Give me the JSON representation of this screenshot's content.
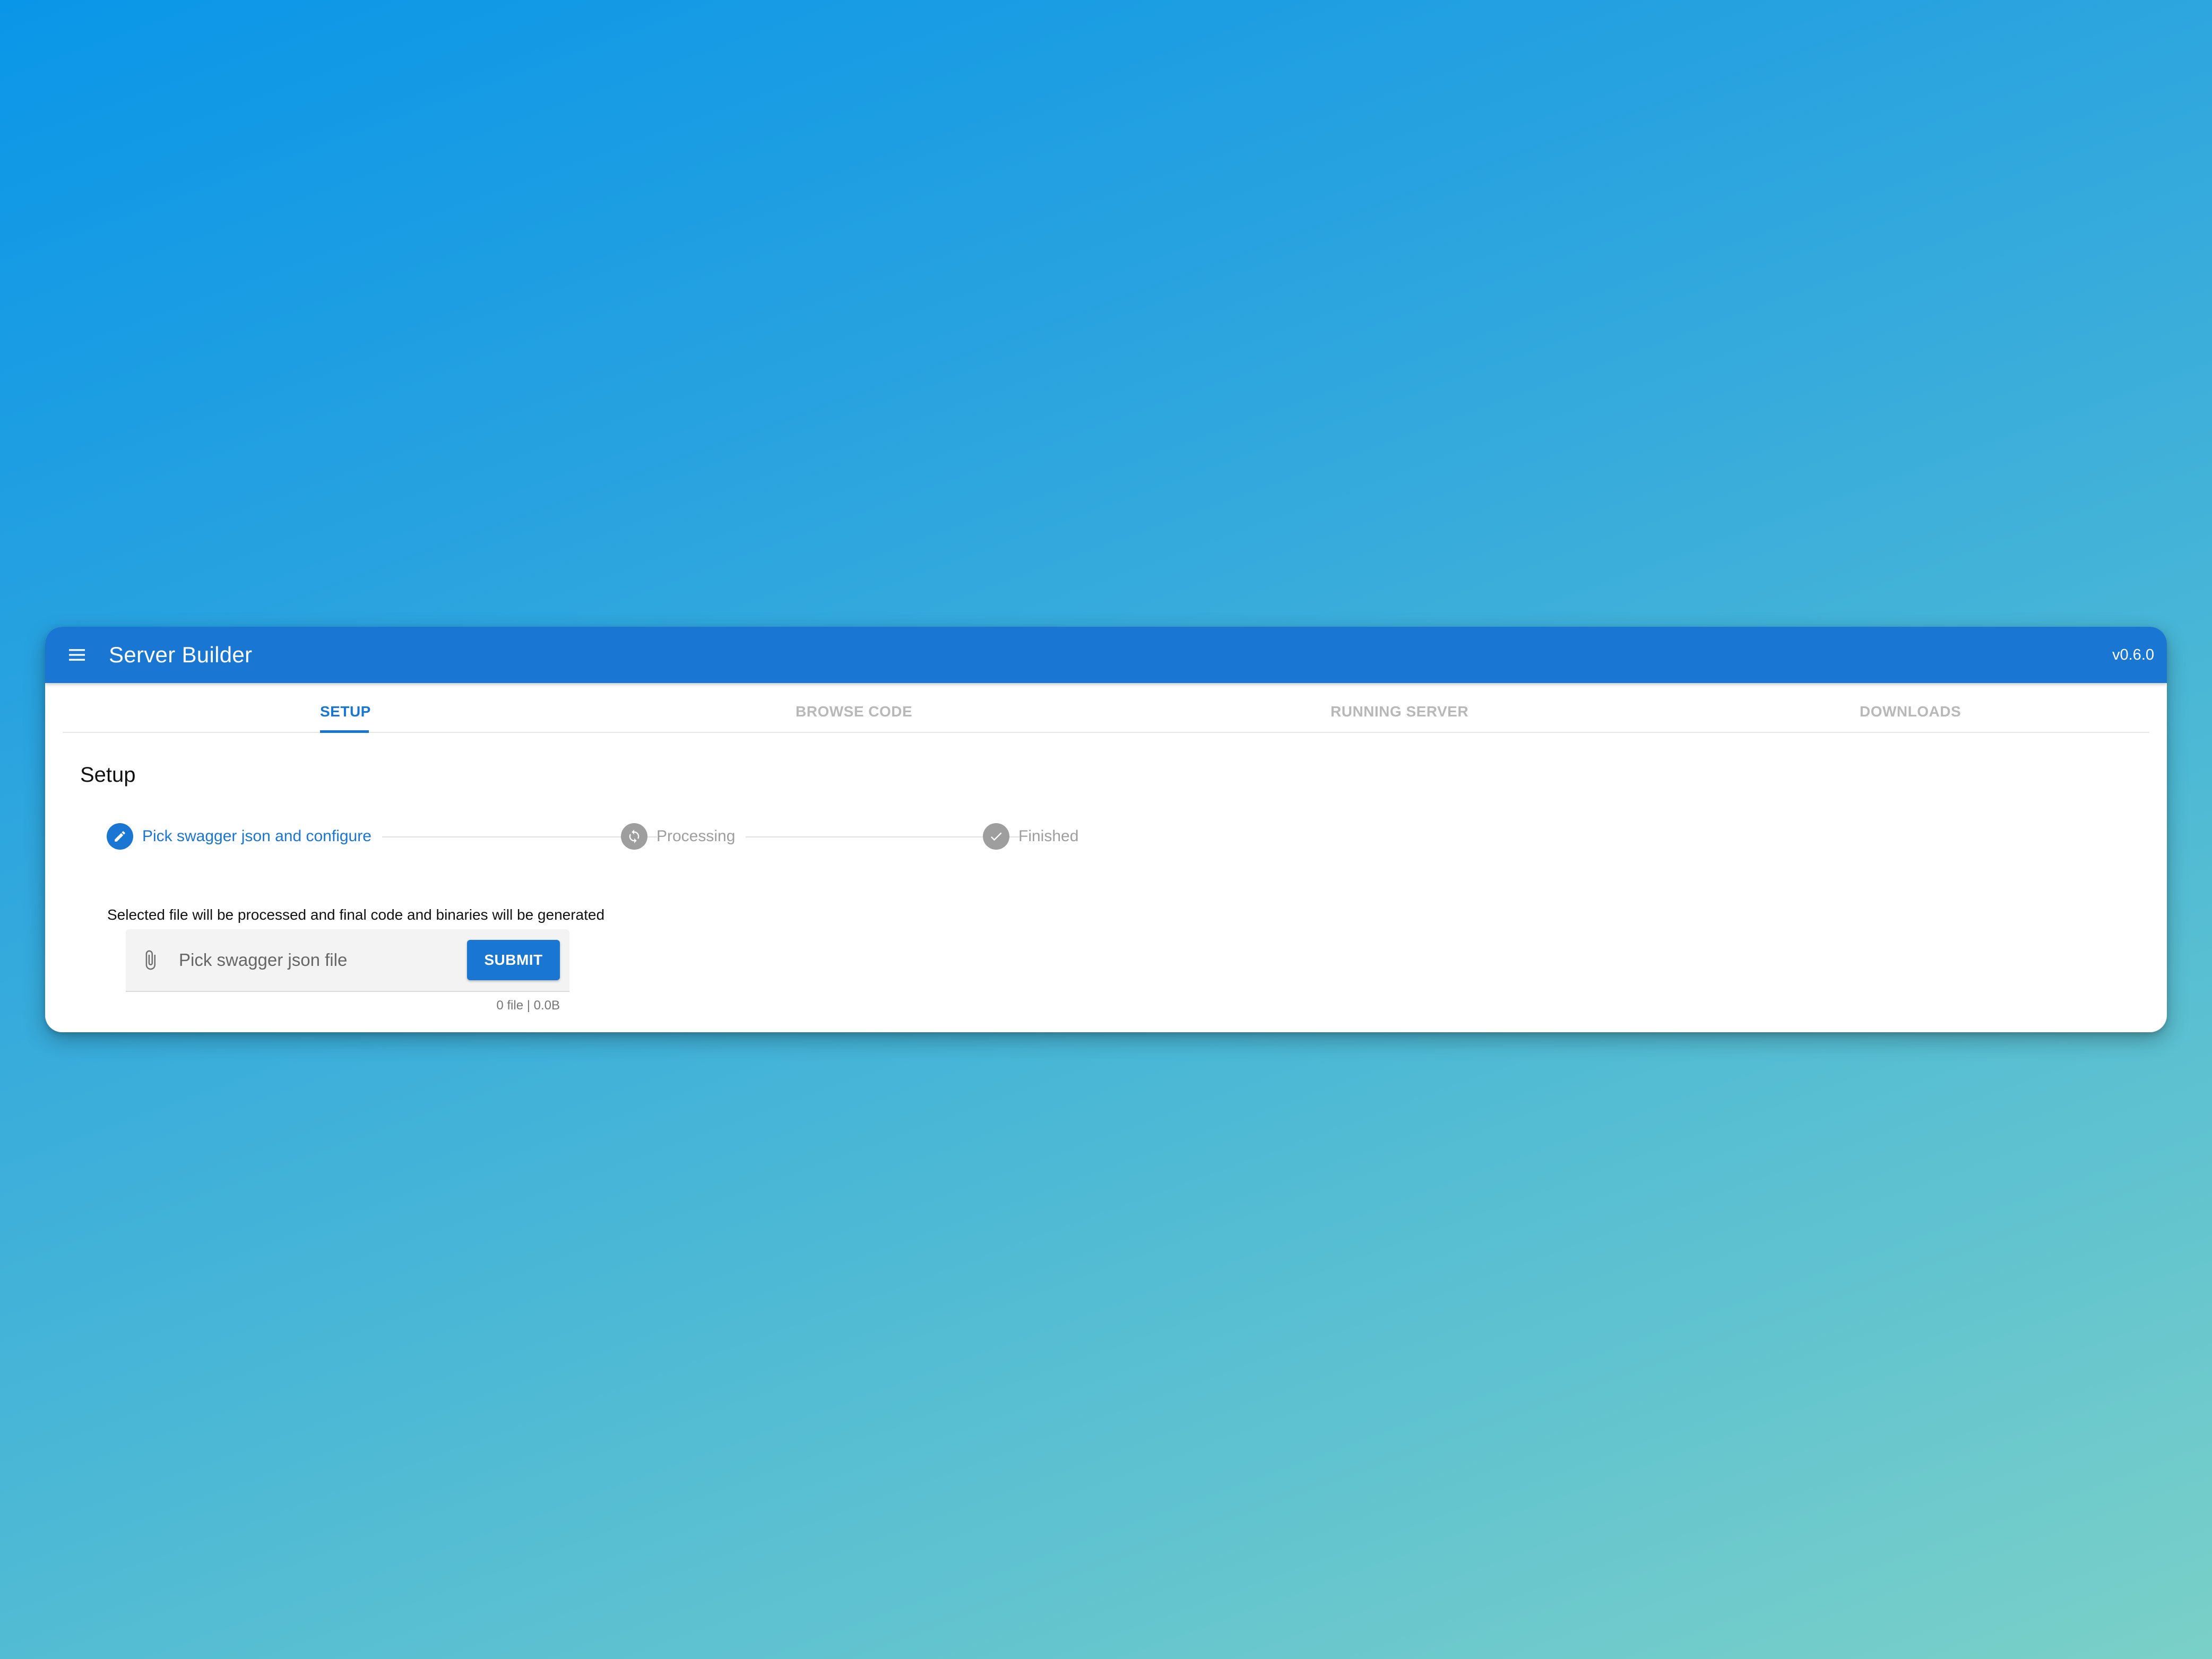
{
  "app": {
    "title": "Server Builder",
    "version": "v0.6.0",
    "accent_color": "#1976d2"
  },
  "icons": {
    "menu": "menu-icon",
    "step_edit": "pencil-icon",
    "step_processing": "sync-icon",
    "step_finished": "check-icon",
    "attach": "paperclip-icon"
  },
  "tabs": [
    {
      "label": "SETUP",
      "active": true
    },
    {
      "label": "BROWSE CODE",
      "active": false
    },
    {
      "label": "RUNNING SERVER",
      "active": false
    },
    {
      "label": "DOWNLOADS",
      "active": false
    }
  ],
  "setup": {
    "heading": "Setup",
    "steps": [
      {
        "label": "Pick swagger json and configure",
        "state": "active"
      },
      {
        "label": "Processing",
        "state": "inactive"
      },
      {
        "label": "Finished",
        "state": "inactive"
      }
    ],
    "description": "Selected file will be processed and final code and binaries will be generated",
    "file_picker": {
      "placeholder": "Pick swagger json file",
      "value": "",
      "submit_label": "SUBMIT",
      "stats": "0 file | 0.0B"
    }
  }
}
